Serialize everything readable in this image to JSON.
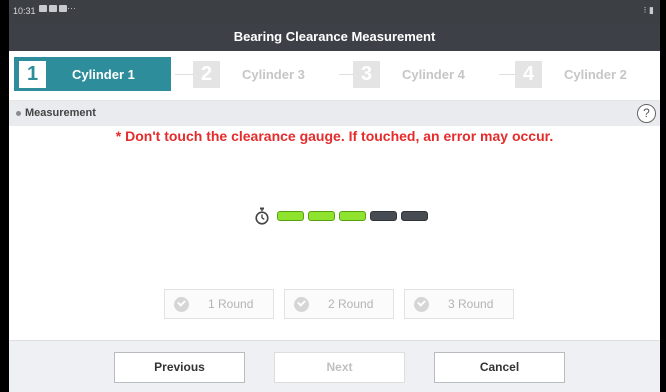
{
  "status_bar": {
    "time": "10:31",
    "overflow": "···",
    "right": "⁝ ▮"
  },
  "window": {
    "title": "Bearing Clearance Measurement"
  },
  "steps": [
    {
      "number": "1",
      "label": "Cylinder 1",
      "state": "active"
    },
    {
      "number": "2",
      "label": "Cylinder 3",
      "state": "inactive"
    },
    {
      "number": "3",
      "label": "Cylinder 4",
      "state": "inactive"
    },
    {
      "number": "4",
      "label": "Cylinder 2",
      "state": "inactive"
    }
  ],
  "section": {
    "title": "Measurement",
    "help_label": "?"
  },
  "warning": "* Don't touch the clearance gauge. If touched, an error may occur.",
  "gauge": {
    "filled_segments": 3,
    "total_segments": 5,
    "on_color": "#8fe22d",
    "off_color": "#474b52"
  },
  "rounds": [
    {
      "label": "1 Round"
    },
    {
      "label": "2 Round"
    },
    {
      "label": "3 Round"
    }
  ],
  "buttons": {
    "previous": "Previous",
    "next": "Next",
    "cancel": "Cancel"
  },
  "colors": {
    "accent": "#2e8d9b",
    "warning": "#e52b2b",
    "title_bar": "#3d4147"
  }
}
